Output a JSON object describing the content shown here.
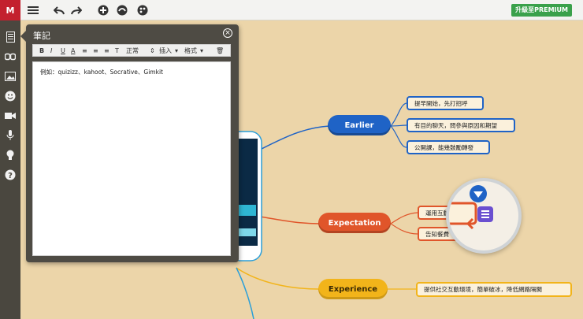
{
  "app": {
    "logo_text": "M"
  },
  "toolbar": {
    "menu_icon": "hamburger-icon",
    "undo_icon": "undo-icon",
    "redo_icon": "redo-icon",
    "add_icon": "add-circle-icon",
    "icon4": "tilt-icon",
    "icon5": "palette-icon",
    "premium_label": "升級至PREMIUM"
  },
  "sidebar": {
    "items": [
      "notes-icon",
      "link-icon",
      "image-icon",
      "emoji-icon",
      "video-icon",
      "mic-icon",
      "idea-icon",
      "help-icon"
    ]
  },
  "notes_panel": {
    "title": "筆記",
    "format": {
      "bold": "B",
      "italic": "I",
      "underline": "U",
      "color": "A",
      "style_label": "正常",
      "insert_label": "插入",
      "format_label": "格式"
    },
    "content": "例如：quizizz、kahoot、Socrative、Gimkit"
  },
  "mindmap": {
    "nodes": [
      {
        "label": "Earlier",
        "color": "#1f63c6"
      },
      {
        "label": "Expectation",
        "color": "#e0552a"
      },
      {
        "label": "Experience",
        "color": "#f2b41a"
      }
    ],
    "leaves": {
      "earlier": [
        "提早開始，先打招呼",
        "有目的聊天，問參與原因和期望",
        "公開課，能幾鼓勵轉發"
      ],
      "expectation": [
        "運用互動",
        "告知餐費"
      ],
      "experience": [
        "提供社交互動環境，簡單破冰，降低網路隔閡"
      ]
    },
    "colors": {
      "earlier": "#1f63c6",
      "expectation": "#e0552a",
      "experience": "#f2b41a"
    }
  }
}
